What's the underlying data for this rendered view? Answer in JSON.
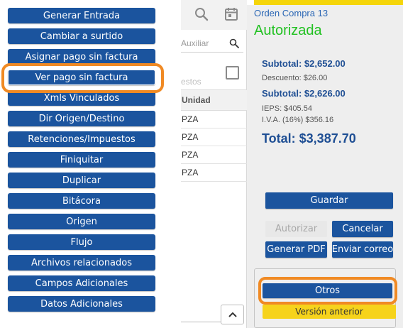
{
  "menu": {
    "items": [
      {
        "label": "Generar Entrada"
      },
      {
        "label": "Cambiar a surtido"
      },
      {
        "label": "Asignar pago sin factura"
      },
      {
        "label": "Ver pago sin factura"
      },
      {
        "label": "Xmls Vinculados"
      },
      {
        "label": "Dir Origen/Destino"
      },
      {
        "label": "Retenciones/Impuestos"
      },
      {
        "label": "Finiquitar"
      },
      {
        "label": "Duplicar"
      },
      {
        "label": "Bitácora"
      },
      {
        "label": "Origen"
      },
      {
        "label": "Flujo"
      },
      {
        "label": "Archivos relacionados"
      },
      {
        "label": "Campos Adicionales"
      },
      {
        "label": "Datos Adicionales"
      }
    ],
    "highlighted_item": "Ver pago sin factura"
  },
  "grid": {
    "search_placeholder": "Auxiliar",
    "ghost_label": "estos",
    "column_header": "Unidad",
    "rows": [
      "PZA",
      "PZA",
      "PZA",
      "PZA"
    ],
    "toolbar_icons": [
      "search-icon",
      "calendar-icon"
    ],
    "scroll_icon": "chevron-up-icon"
  },
  "panel": {
    "order_title": "Orden Compra 13",
    "status": "Autorizada",
    "subtotal_1": "Subtotal: $2,652.00",
    "descuento": "Descuento: $26.00",
    "subtotal_2": "Subtotal: $2,626.00",
    "ieps": "IEPS: $405.54",
    "iva": "I.V.A. (16%) $356.16",
    "total": "Total: $3,387.70",
    "buttons": {
      "guardar": "Guardar",
      "autorizar": "Autorizar",
      "cancelar": "Cancelar",
      "generar_pdf": "Generar PDF",
      "enviar_correo": "Enviar correo",
      "otros": "Otros",
      "version_anterior": "Versión anterior"
    }
  },
  "colors": {
    "primary_button": "#1b549e",
    "highlight": "#f08a24",
    "status_green": "#22c122",
    "accent_yellow": "#f6d31b",
    "totals_blue": "#1f4f94"
  }
}
